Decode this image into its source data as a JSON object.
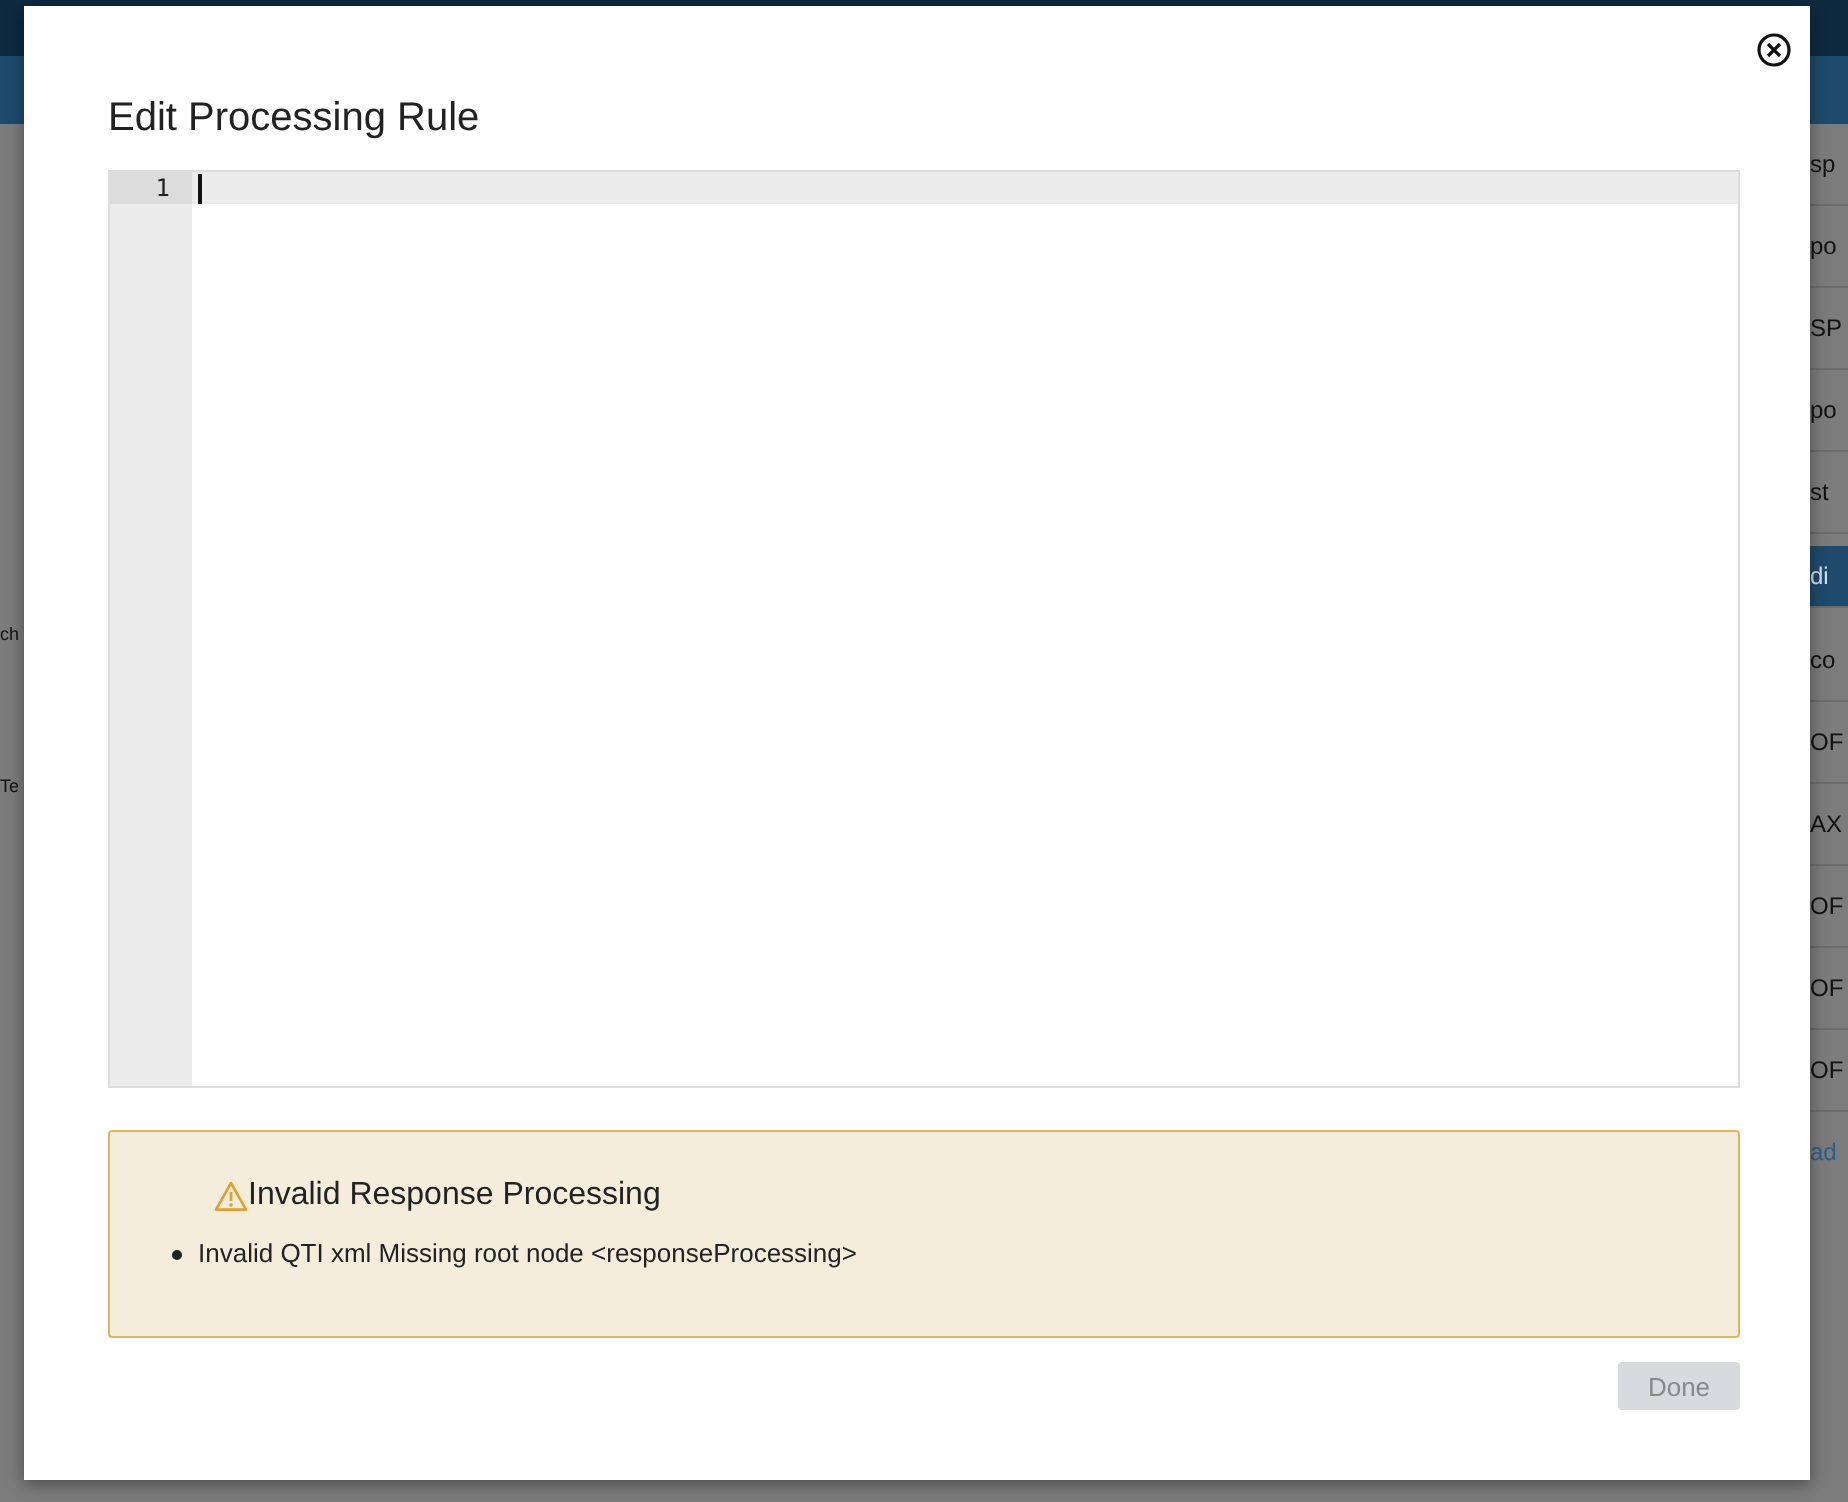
{
  "backdrop": {
    "left_fragments": [
      {
        "text": "ch",
        "kind": "text"
      },
      {
        "text": "Te",
        "kind": "text"
      }
    ],
    "right_fragments": [
      {
        "text": "sp",
        "kind": "text"
      },
      {
        "text": "po",
        "kind": "text"
      },
      {
        "text": "SP",
        "kind": "text"
      },
      {
        "text": "po",
        "kind": "text"
      },
      {
        "text": "st",
        "kind": "text"
      },
      {
        "text": "di",
        "kind": "band"
      },
      {
        "text": "co",
        "kind": "text"
      },
      {
        "text": "OF",
        "kind": "text"
      },
      {
        "text": "AX",
        "kind": "text"
      },
      {
        "text": "OF",
        "kind": "text"
      },
      {
        "text": "OF",
        "kind": "text"
      },
      {
        "text": "OF",
        "kind": "text"
      },
      {
        "text": "ad",
        "kind": "link"
      }
    ]
  },
  "dialog": {
    "title": "Edit Processing Rule",
    "editor": {
      "line_numbers": [
        "1"
      ]
    },
    "alert": {
      "title": "Invalid Response Processing",
      "items": [
        "Invalid QTI xml Missing root node <responseProcessing>"
      ]
    },
    "buttons": [
      {
        "label": "Done",
        "disabled": true
      }
    ]
  }
}
